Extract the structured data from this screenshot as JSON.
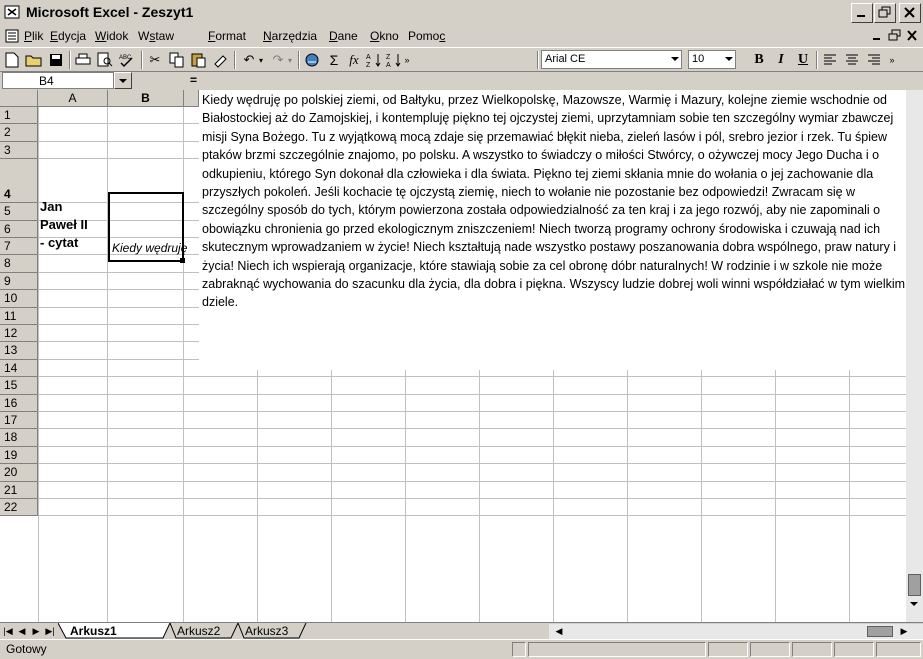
{
  "window": {
    "title": "Microsoft Excel - Zeszyt1"
  },
  "menu": {
    "items": [
      "Plik",
      "Edycja",
      "Widok",
      "Wstaw",
      "Format",
      "Narzędzia",
      "Dane",
      "Okno",
      "Pomoc"
    ]
  },
  "toolbar": {
    "font_name": "Arial CE",
    "font_size": "10",
    "bold_label": "B",
    "italic_label": "I",
    "underline_label": "U"
  },
  "formula_bar": {
    "name_box": "B4",
    "equals": "="
  },
  "grid": {
    "columns": [
      "A",
      "B"
    ],
    "rows": [
      "1",
      "2",
      "3",
      "4",
      "5",
      "6",
      "7",
      "8",
      "9",
      "10",
      "11",
      "12",
      "13",
      "14",
      "15",
      "16",
      "17",
      "18",
      "19",
      "20",
      "21",
      "22"
    ],
    "cell_a4": "Jan\nPaweł II\n- cytat",
    "cell_b4": "Kiedy wędruję"
  },
  "cell_tooltip_text": "Kiedy wędruję po polskiej ziemi, od Bałtyku, przez Wielkopolskę, Mazowsze, Warmię i Mazury, kolejne ziemie wschodnie od Białostockiej aż do Zamojskiej, i kontempluję piękno tej ojczystej ziemi, uprzytamniam sobie ten szczególny wymiar zbawczej misji Syna Bożego. Tu z wyjątkową mocą zdaje się przemawiać błękit nieba, zieleń lasów i pól, srebro jezior i rzek. Tu śpiew ptaków brzmi szczególnie znajomo, po polsku. A wszystko to świadczy o miłości Stwórcy, o ożywczej mocy Jego Ducha i o odkupieniu, którego Syn dokonał dla człowieka i dla świata. Piękno tej ziemi skłania mnie do wołania o jej zachowanie dla przyszłych pokoleń. Jeśli kochacie tę ojczystą ziemię, niech to wołanie nie pozostanie bez odpowiedzi! Zwracam się w szczególny sposób do tych, którym powierzona została odpowiedzialność za ten kraj i za jego rozwój, aby nie zapominali o obowiązku chronienia go przed ekologicznym zniszczeniem! Niech tworzą programy ochrony środowiska i czuwają nad ich skutecznym wprowadzaniem w życie! Niech kształtują nade wszystko postawy poszanowania dobra wspólnego, praw natury i życia! Niech ich wspierają organizacje, które stawiają sobie za cel obronę dóbr naturalnych! W rodzinie i w szkole nie może zabraknąć wychowania do szacunku dla życia, dla dobra i piękna. Wszyscy ludzie dobrej woli winni współdziałać w tym wielkim dziele.",
  "sheets": {
    "tabs": [
      "Arkusz1",
      "Arkusz2",
      "Arkusz3"
    ],
    "active": "Arkusz1"
  },
  "status": {
    "text": "Gotowy"
  }
}
